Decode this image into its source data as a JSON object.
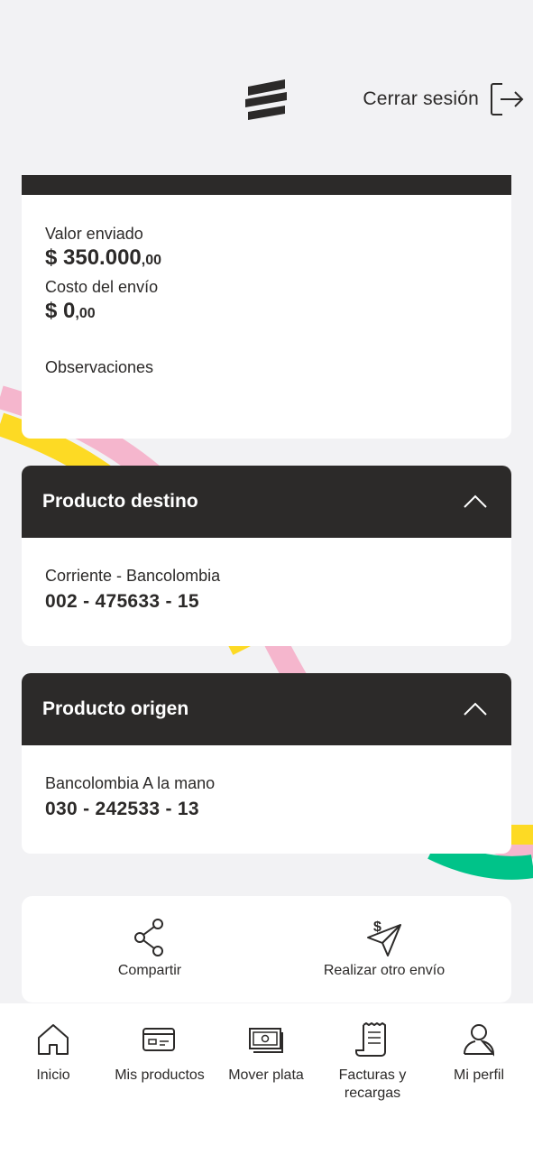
{
  "header": {
    "logo_icon": "bancolombia-logo-icon",
    "logout_label": "Cerrar sesión",
    "logout_icon": "logout-icon"
  },
  "summary": {
    "sent_label": "Valor enviado",
    "sent_int": "$ 350.000",
    "sent_dec": ",00",
    "cost_label": "Costo del envío",
    "cost_int": "$ 0",
    "cost_dec": ",00",
    "notes_label": "Observaciones"
  },
  "destination": {
    "title": "Producto destino",
    "account_type": "Corriente - Bancolombia",
    "account_number": "002 - 475633 - 15"
  },
  "origin": {
    "title": "Producto origen",
    "account_type": "Bancolombia A la mano",
    "account_number": "030 - 242533 - 13"
  },
  "actions": {
    "share_label": "Compartir",
    "another_label": "Realizar otro envío"
  },
  "nav": {
    "items": [
      {
        "label": "Inicio",
        "icon": "home-icon"
      },
      {
        "label": "Mis productos",
        "icon": "card-icon"
      },
      {
        "label": "Mover plata",
        "icon": "money-icon"
      },
      {
        "label": "Facturas y recargas",
        "icon": "receipt-icon"
      },
      {
        "label": "Mi perfil",
        "icon": "user-icon"
      }
    ]
  },
  "colors": {
    "background": "#f2f2f4",
    "dark": "#2c2a29",
    "card": "#ffffff",
    "yellow": "#fdda24",
    "pink": "#f5b6cd",
    "green": "#00c389"
  }
}
